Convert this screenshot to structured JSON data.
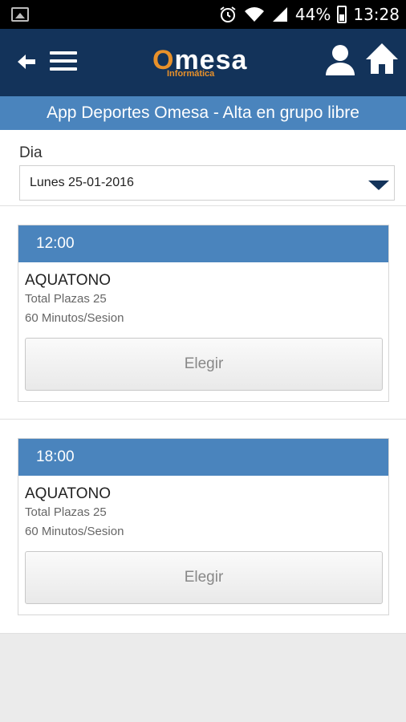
{
  "status_bar": {
    "battery": "44%",
    "time": "13:28",
    "icons": [
      "image-icon",
      "alarm-icon",
      "wifi-icon",
      "signal-icon",
      "battery-icon"
    ]
  },
  "app_bar": {
    "logo_word_rest": "mesa",
    "logo_sub": "Informática",
    "icons": [
      "back-arrow-icon",
      "menu-icon",
      "user-icon",
      "home-icon"
    ]
  },
  "subheader": {
    "title": "App Deportes Omesa - Alta en grupo libre"
  },
  "day": {
    "label": "Dia",
    "selected": "Lunes 25-01-2016"
  },
  "slots": [
    {
      "time": "12:00",
      "activity": "AQUATONO",
      "places": "Total Plazas 25",
      "duration": "60 Minutos/Sesion",
      "button": "Elegir"
    },
    {
      "time": "18:00",
      "activity": "AQUATONO",
      "places": "Total Plazas 25",
      "duration": "60 Minutos/Sesion",
      "button": "Elegir"
    }
  ],
  "colors": {
    "app_bar": "#13335a",
    "accent_blue": "#4a84bd",
    "logo_orange": "#e8912a"
  }
}
